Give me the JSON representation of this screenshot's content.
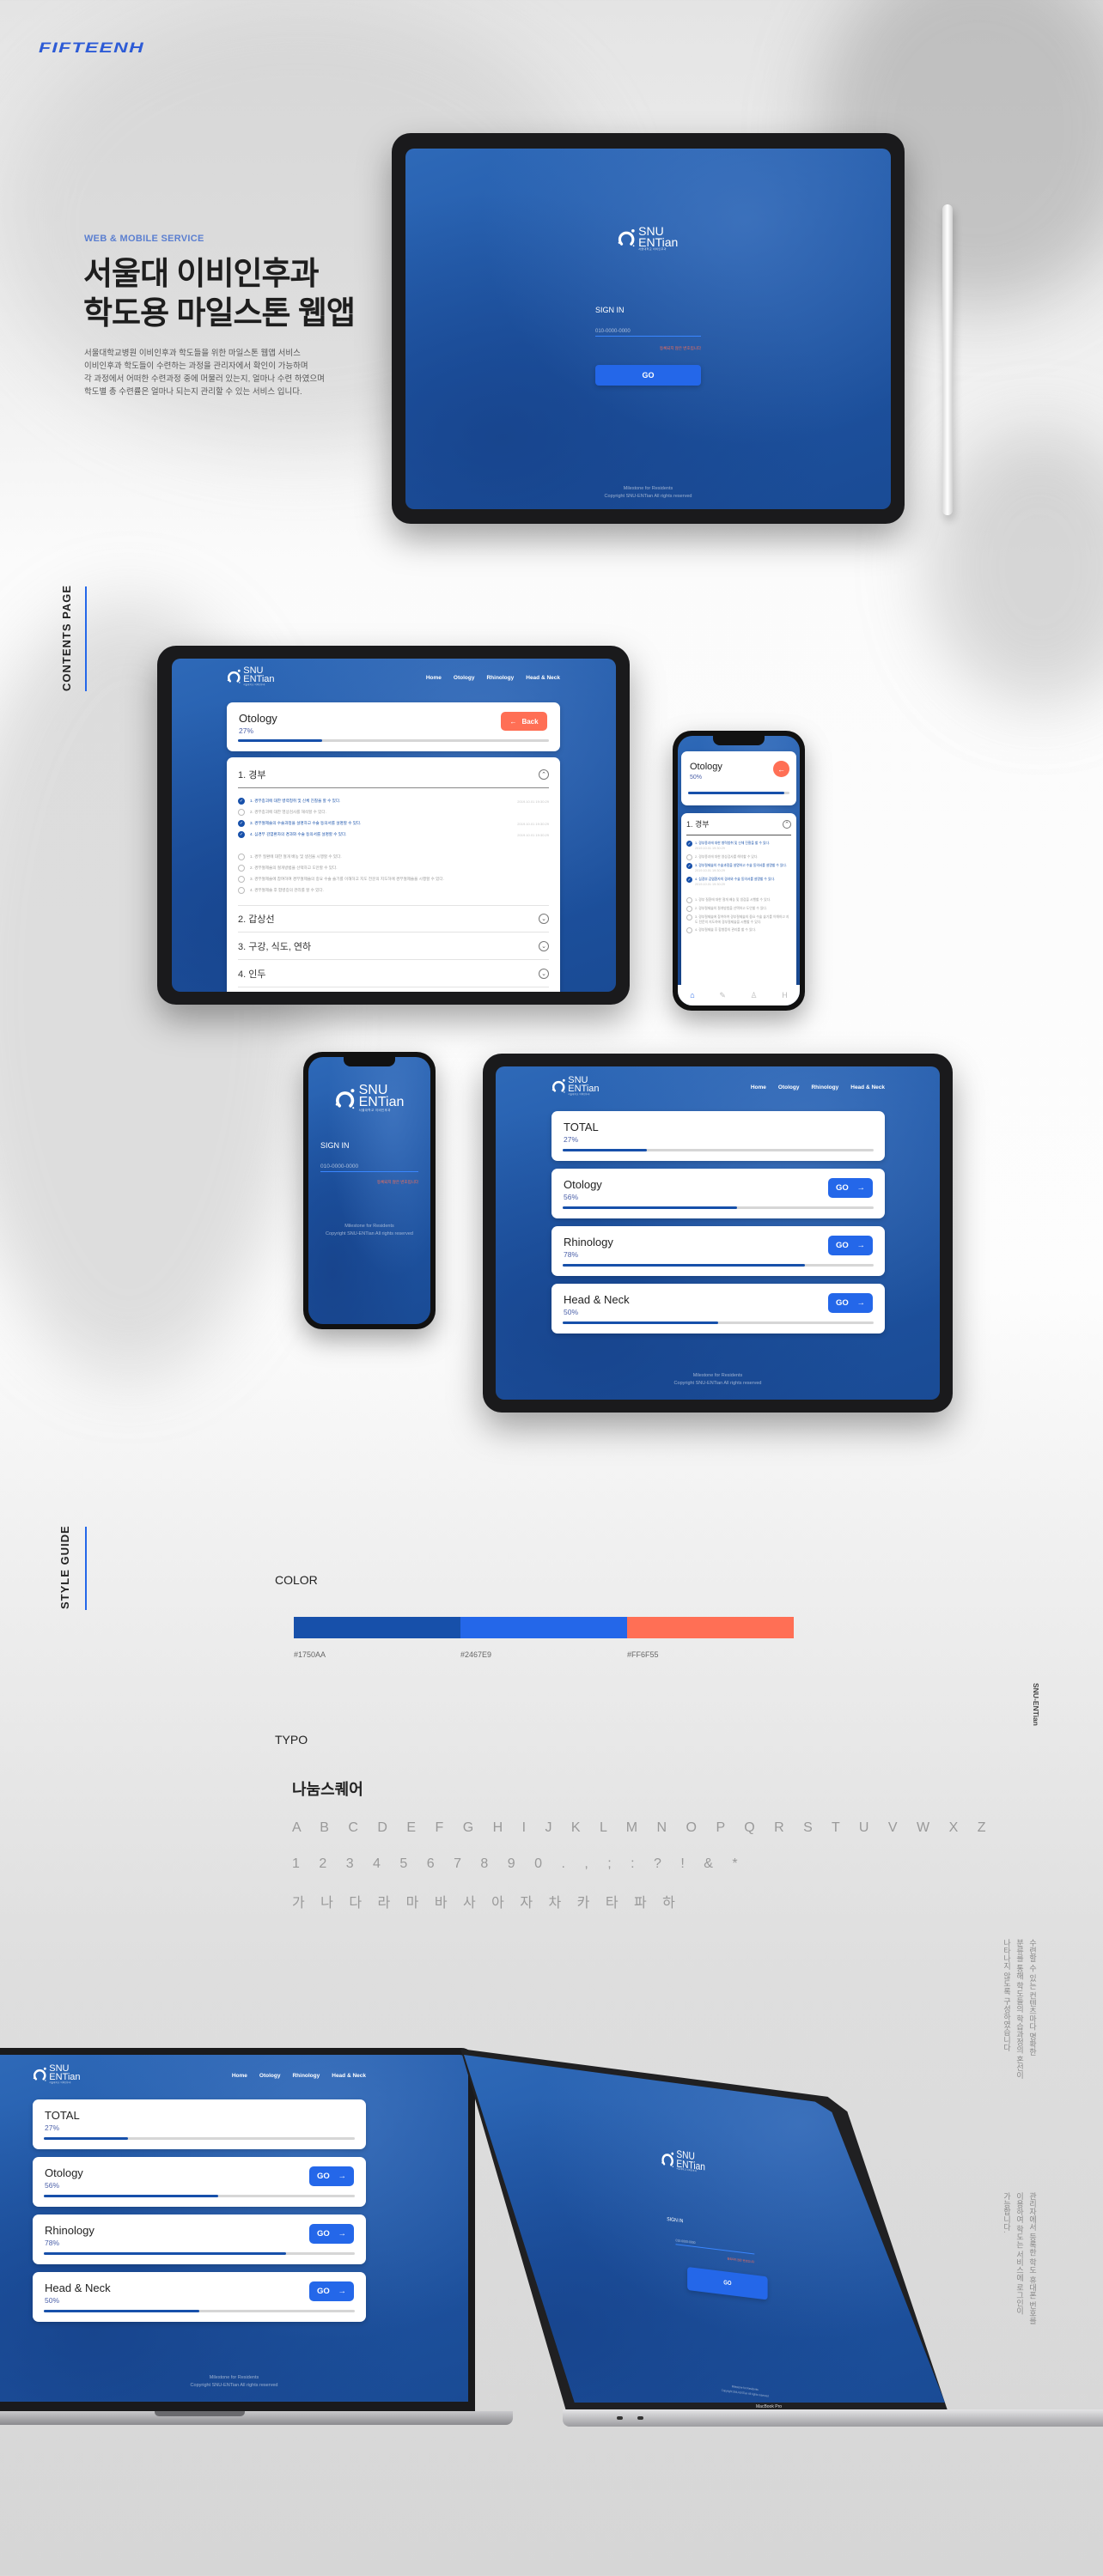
{
  "brand": {
    "logo": "FIFTEENH",
    "color": "#2D5BD6"
  },
  "intro": {
    "eyebrow": "WEB & MOBILE SERVICE",
    "title_line1": "서울대 이비인후과",
    "title_line2": "학도용 마일스톤 웹앱",
    "description": [
      "서울대학교병원 이비인후과 학도들을 위한 마일스톤 웹앱 서비스",
      "이비인후과 학도들이 수련하는 과정을 관리자에서 확인이 가능하며",
      "각 과정에서 어떠한 수련과정 중에 머물러 있는지, 얼마나 수련 하였으며",
      "학도별 총 수련률은 얼마나 되는지 관리할 수 있는 서비스 입니다."
    ]
  },
  "sections": {
    "contents": "CONTENTS PAGE",
    "style": "STYLE GUIDE"
  },
  "app_logo": {
    "line1": "SNU",
    "line2": "ENTian",
    "subtitle": "서울대학교 이비인후과"
  },
  "login": {
    "title": "SIGN IN",
    "phone_placeholder": "010-0000-0000",
    "error": "등록되지 않은 번호입니다",
    "go": "GO",
    "footer_line1": "Milestone for Residents",
    "footer_line2": "Copyright SNU-ENTian All rights reserved"
  },
  "nav": [
    "Home",
    "Otology",
    "Rhinology",
    "Head & Neck"
  ],
  "dashboard": {
    "cards": [
      {
        "title": "TOTAL",
        "percent_label": "27%",
        "progress": 0.27
      },
      {
        "title": "Otology",
        "percent_label": "56%",
        "progress": 0.56,
        "button": "GO"
      },
      {
        "title": "Rhinology",
        "percent_label": "78%",
        "progress": 0.78,
        "button": "GO"
      },
      {
        "title": "Head & Neck",
        "percent_label": "50%",
        "progress": 0.5,
        "button": "GO"
      }
    ]
  },
  "detail": {
    "title": "Otology",
    "percent_label": "27%",
    "progress": 0.27,
    "back": "Back",
    "sections": [
      {
        "title": "1. 경부",
        "expanded": true
      },
      {
        "title": "2. 갑상선",
        "expanded": false
      },
      {
        "title": "3. 구강, 식도, 연하",
        "expanded": false
      },
      {
        "title": "4. 인두",
        "expanded": false
      }
    ],
    "items_group1": [
      {
        "text": "1. 경부종괴에 대한 병력청취 및 신체 진찰을 할 수 있다.",
        "checked": true,
        "timestamp": "2019.10.01 19:30:29"
      },
      {
        "text": "2. 경부종괴에 대한 영상검사를 해석할 수 있다.",
        "checked": false,
        "timestamp": ""
      },
      {
        "text": "3. 경부절제술의 수술과정을 설명하고 수술 동의서를 설명할 수 있다.",
        "checked": true,
        "timestamp": "2019.10.01 19:30:29"
      },
      {
        "text": "4. 심경부 감염환자의 경과와 수술 동의서를 설명할 수 있다.",
        "checked": true,
        "timestamp": "2019.10.01 19:30:29"
      }
    ],
    "items_group2": [
      {
        "text": "1. 경부 질환에 대한 절개 배농 및 생검을 시행할 수 있다.",
        "checked": false,
        "timestamp": ""
      },
      {
        "text": "2. 경부절제술의 절개방법을 선택하고 도안할 수 있다.",
        "checked": false,
        "timestamp": ""
      },
      {
        "text": "3. 경부절제술에 참여하여 경부절제술의 중요 수술 술기를 이해하고 지도 전문의 지도하에 경부절제술을 시행할 수 있다.",
        "checked": false,
        "timestamp": ""
      },
      {
        "text": "4. 경부절제술 후 합병증의 관리를 할 수 있다.",
        "checked": false,
        "timestamp": ""
      }
    ]
  },
  "mobile_detail": {
    "title": "Otology",
    "percent_label": "50%",
    "progress": 0.95,
    "tabs": [
      "home-icon",
      "edit-icon",
      "user-icon",
      "hospital-icon"
    ]
  },
  "colors": {
    "label": "COLOR",
    "swatches": [
      {
        "hex": "#1750AA"
      },
      {
        "hex": "#2467E9"
      },
      {
        "hex": "#FF6F55"
      }
    ]
  },
  "typo": {
    "label": "TYPO",
    "font_name": "나눔스퀘어",
    "alphabet": "A B C D E F G H I J K L M N O P Q R S T U V W X Z",
    "numbers": "1 2 3 4 5 6 7 8 9 0  . , ; : ? ! & *",
    "hangul": "가 나 다 라 마 바 사 아 자 차 카 타 파 하"
  },
  "side": {
    "brand": "SNU-ENTian",
    "note1": [
      "수련할 수 있는 컨텐츠마다 명확한",
      "분류를 통해 학도들의 학습과정의 혼선이",
      "나타나지 않도록 구성하였습니다"
    ],
    "note2": [
      "관리자에서 등록한 학도 휴대폰 번호를",
      "이용하여 학도는 서비스에 로그인이",
      "가능합니다."
    ]
  },
  "device": {
    "laptop_label": "MacBook Pro"
  }
}
